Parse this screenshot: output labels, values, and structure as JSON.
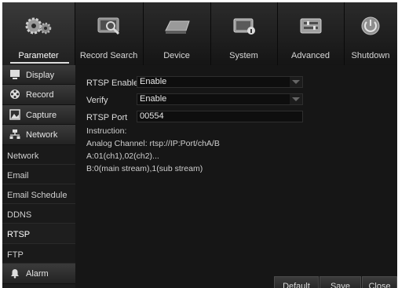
{
  "nav": [
    {
      "label": "Parameter",
      "icon": "gears-icon",
      "active": true
    },
    {
      "label": "Record Search",
      "icon": "record-search-icon"
    },
    {
      "label": "Device",
      "icon": "hdd-icon"
    },
    {
      "label": "System",
      "icon": "system-info-icon"
    },
    {
      "label": "Advanced",
      "icon": "advanced-icon"
    },
    {
      "label": "Shutdown",
      "icon": "power-icon"
    }
  ],
  "sidebar": {
    "groups": {
      "display": {
        "label": "Display",
        "icon": "monitor-icon"
      },
      "record": {
        "label": "Record",
        "icon": "film-reel-icon"
      },
      "capture": {
        "label": "Capture",
        "icon": "capture-icon"
      },
      "network": {
        "label": "Network",
        "icon": "network-icon"
      },
      "alarm": {
        "label": "Alarm",
        "icon": "alarm-bell-icon"
      }
    },
    "network_items": [
      "Network",
      "Email",
      "Email Schedule",
      "DDNS",
      "RTSP",
      "FTP"
    ],
    "active_item": "RTSP"
  },
  "rtsp": {
    "enable_label": "RTSP Enable",
    "enable_value": "Enable",
    "verify_label": "Verify",
    "verify_value": "Enable",
    "port_label": "RTSP Port",
    "port_value": "00554",
    "instruction_title": "Instruction:",
    "instruction_lines": [
      "Analog Channel:  rtsp://IP:Port/chA/B",
      "A:01(ch1),02(ch2)...",
      "B:0(main stream),1(sub stream)"
    ]
  },
  "buttons": {
    "default": "Default",
    "save": "Save",
    "close": "Close"
  }
}
